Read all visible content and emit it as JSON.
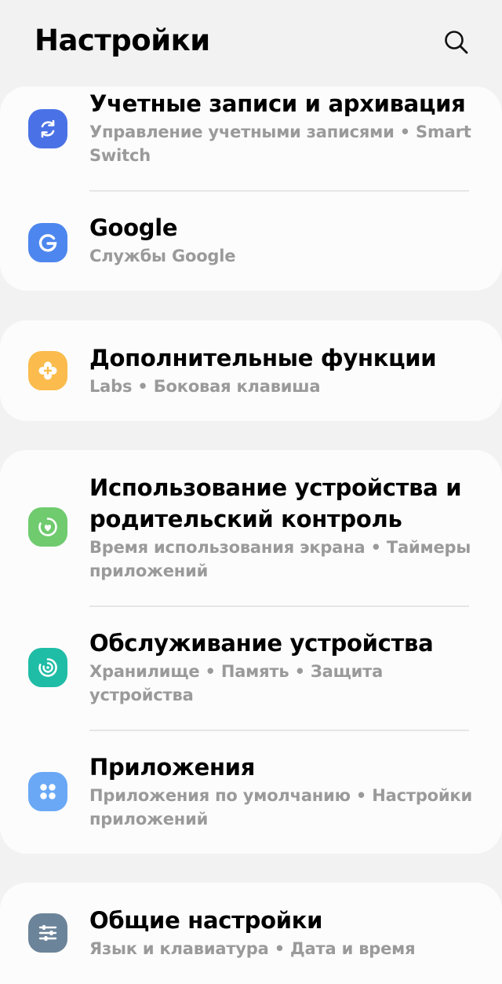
{
  "header": {
    "title": "Настройки",
    "search_icon": "search-icon"
  },
  "colors": {
    "accounts": "#4a72e6",
    "google": "#4d86ee",
    "advanced": "#fbbc4d",
    "wellbeing": "#6fcb6e",
    "care": "#1fbca6",
    "apps": "#6aa8f6",
    "general": "#6c8499"
  },
  "items": [
    {
      "id": "accounts",
      "icon": "sync-icon",
      "label": "Учетные записи и архивация",
      "sub": "Управление учетными записями  •  Smart Switch"
    },
    {
      "id": "google",
      "icon": "google-icon",
      "label": "Google",
      "sub": "Службы Google"
    },
    {
      "id": "advanced",
      "icon": "plus-gear-icon",
      "label": "Дополнительные функции",
      "sub": "Labs  •  Боковая клавиша"
    },
    {
      "id": "wellbeing",
      "icon": "heart-ring-icon",
      "label": "Использование устройства и родительский контроль",
      "sub": "Время использования экрана  •  Таймеры приложений"
    },
    {
      "id": "care",
      "icon": "device-care-icon",
      "label": "Обслуживание устройства",
      "sub": "Хранилище  •  Память  •  Защита устройства"
    },
    {
      "id": "apps",
      "icon": "apps-grid-icon",
      "label": "Приложения",
      "sub": "Приложения по умолчанию  •  Настройки приложений"
    },
    {
      "id": "general",
      "icon": "sliders-icon",
      "label": "Общие настройки",
      "sub": "Язык и клавиатура  •  Дата и время"
    }
  ]
}
